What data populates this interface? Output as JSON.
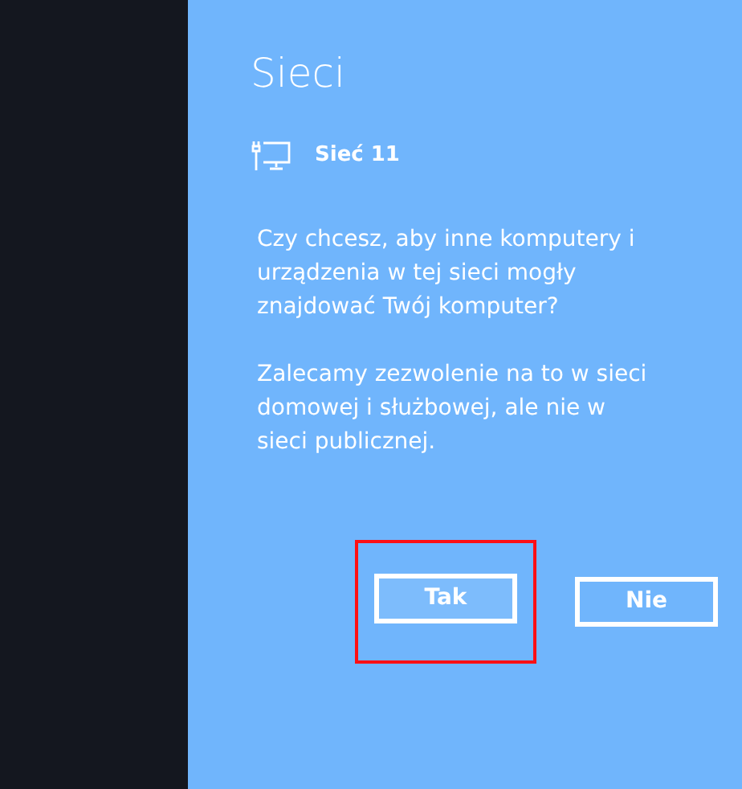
{
  "panel": {
    "title": "Sieci",
    "network": {
      "name": "Sieć 11"
    },
    "paragraphs": [
      "Czy chcesz, aby inne komputery i urządzenia w tej sieci mogły znajdować Twój komputer?",
      "Zalecamy zezwolenie na to w sieci domowej i służbowej, ale nie w sieci publicznej."
    ],
    "buttons": [
      {
        "label": "Tak",
        "focused": true,
        "highlighted": true
      },
      {
        "label": "Nie",
        "focused": false,
        "highlighted": false
      }
    ]
  }
}
